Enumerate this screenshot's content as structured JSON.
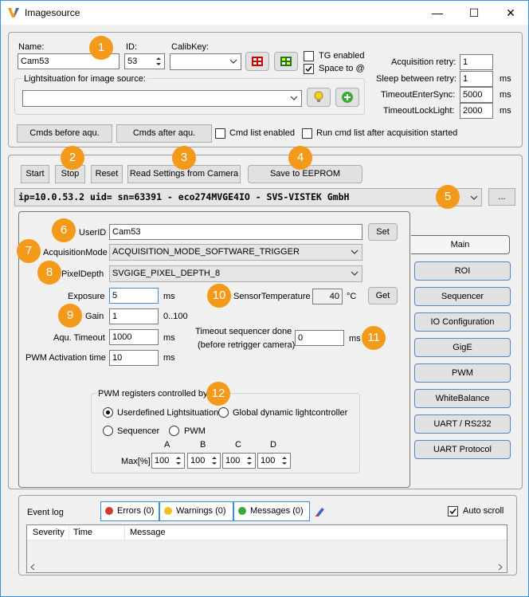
{
  "window": {
    "title": "Imagesource"
  },
  "top": {
    "name_label": "Name:",
    "name_value": "Cam53",
    "id_label": "ID:",
    "id_value": "53",
    "calib_label": "CalibKey:",
    "tg_enabled": "TG enabled",
    "space_to": "Space to @",
    "lightsituation_label": "Lightsituation for image source:",
    "acq_retry_label": "Acquisition retry:",
    "acq_retry_value": "1",
    "sleep_label": "Sleep between retry:",
    "sleep_value": "1",
    "sleep_unit": "ms",
    "tes_label": "TimeoutEnterSync:",
    "tes_value": "5000",
    "tes_unit": "ms",
    "tll_label": "TimeoutLockLight:",
    "tll_value": "2000",
    "tll_unit": "ms",
    "cmds_before": "Cmds before aqu.",
    "cmds_after": "Cmds after aqu.",
    "cmd_list_enabled": "Cmd list enabled",
    "run_cmd_list": "Run cmd list after acquisition started"
  },
  "camera": {
    "start": "Start",
    "stop": "Stop",
    "reset": "Reset",
    "read_settings": "Read Settings from Camera",
    "save_eeprom": "Save to EEPROM",
    "device": "ip=10.0.53.2 uid= sn=63391 - eco274MVGE4IO - SVS-VISTEK GmbH",
    "more": "..."
  },
  "main": {
    "userid_label": "UserID",
    "userid_value": "Cam53",
    "set": "Set",
    "acqmode_label": "AcquisitionMode",
    "acqmode_value": "ACQUISITION_MODE_SOFTWARE_TRIGGER",
    "pixeldepth_label": "PixelDepth",
    "pixeldepth_value": "SVGIGE_PIXEL_DEPTH_8",
    "exposure_label": "Exposure",
    "exposure_value": "5",
    "exposure_unit": "ms",
    "sensortemp_label": "SensorTemperature",
    "sensortemp_value": "40",
    "sensortemp_unit": "°C",
    "get": "Get",
    "gain_label": "Gain",
    "gain_value": "1",
    "gain_range": "0..100",
    "aqu_timeout_label": "Aqu. Timeout",
    "aqu_timeout_value": "1000",
    "aqu_timeout_unit": "ms",
    "ts_label1": "Timeout sequencer done",
    "ts_label2": "(before retrigger camera)",
    "ts_value": "0",
    "ts_unit": "ms",
    "pwm_time_label": "PWM Activation time",
    "pwm_time_value": "10",
    "pwm_time_unit": "ms",
    "pwm_group": "PWM registers controlled by",
    "r_userdefined": "Userdefined Lightsituation",
    "r_global": "Global dynamic lightcontroller",
    "r_sequencer": "Sequencer",
    "r_pwm": "PWM",
    "max_label": "Max[%]",
    "cols": [
      "A",
      "B",
      "C",
      "D"
    ],
    "vals": [
      "100",
      "100",
      "100",
      "100"
    ]
  },
  "side": [
    "Main",
    "ROI",
    "Sequencer",
    "IO Configuration",
    "GigE",
    "PWM",
    "WhiteBalance",
    "UART / RS232",
    "UART Protocol"
  ],
  "log": {
    "title": "Event log",
    "errors": "Errors (0)",
    "warnings": "Warnings (0)",
    "messages": "Messages (0)",
    "auto_scroll": "Auto scroll",
    "cols": [
      "Severity",
      "Time",
      "Message"
    ]
  },
  "badges": [
    "1",
    "2",
    "3",
    "4",
    "5",
    "6",
    "7",
    "8",
    "9",
    "10",
    "11",
    "12"
  ],
  "colors": {
    "badge": "#f39a1a",
    "accent": "#3c8ee0"
  }
}
